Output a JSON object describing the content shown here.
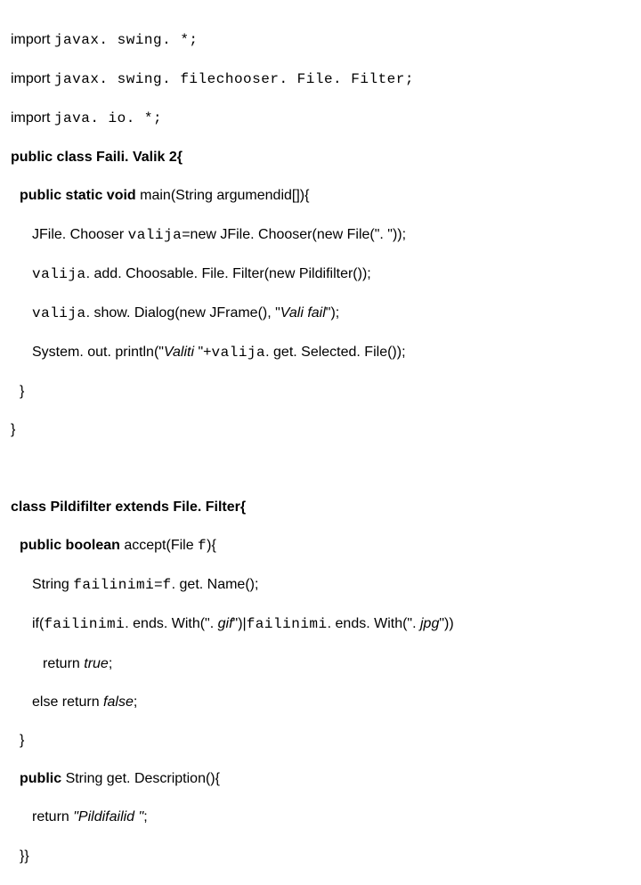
{
  "lines": {
    "l1a": "import ",
    "l1b": "javax. swing. *;",
    "l2a": "import ",
    "l2b": "javax. swing. filechooser. File. Filter;",
    "l3a": "import ",
    "l3b": "java. io. *;",
    "l4a": "public class ",
    "l4b": "Faili. Valik 2{",
    "l5a": "public static void ",
    "l5b": "main(String argumendid[]){",
    "l6a": "JFile. Chooser ",
    "l6b": "valija",
    "l6c": "=new JFile. Chooser(new File(\". \"));",
    "l7a": "valija",
    "l7b": ". add. Choosable. File. Filter(new Pildifilter());",
    "l8a": "valija",
    "l8b": ". show. Dialog(new JFrame(), \"",
    "l8c": "Vali fail",
    "l8d": "\");",
    "l9a": "System. out. println(\"",
    "l9b": "Valiti ",
    "l9c": "\"+",
    "l9d": "valija",
    "l9e": ". get. Selected. File());",
    "l10": "}",
    "l11": "}",
    "blank": " ",
    "l12a": "class ",
    "l12b": "Pildifilter ",
    "l12c": "extends ",
    "l12d": "File. Filter{",
    "l13a": "public boolean ",
    "l13b": "accept(File ",
    "l13c": "f",
    "l13d": "){",
    "l14a": "String ",
    "l14b": "failinimi",
    "l14c": "=",
    "l14d": "f",
    "l14e": ". get. Name();",
    "l15a": "if(",
    "l15b": "failinimi",
    "l15c": ". ends. With(\". ",
    "l15d": "gif",
    "l15e": "\")|",
    "l15f": "failinimi",
    "l15g": ". ends. With(\". ",
    "l15h": "jpg",
    "l15i": "\"))",
    "l16a": "return ",
    "l16b": "true",
    "l16c": ";",
    "l17a": "else return ",
    "l17b": "false",
    "l17c": ";",
    "l18": "}",
    "l19a": "public ",
    "l19b": "String get. Description(){",
    "l20a": "return ",
    "l20b": "\"Pildifailid \"",
    "l20c": ";",
    "l21": "}}"
  }
}
